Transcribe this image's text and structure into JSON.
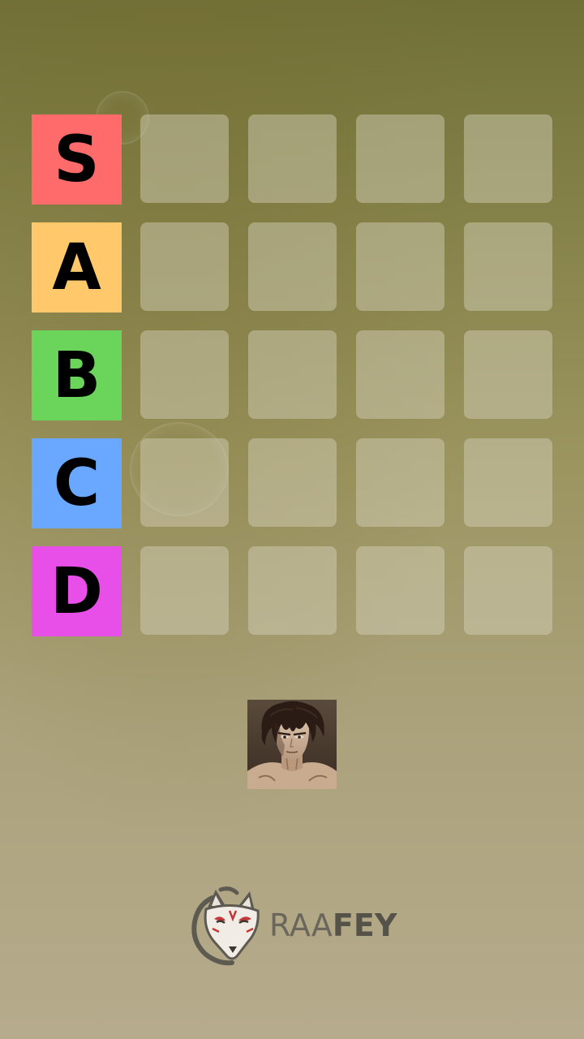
{
  "tiers": [
    {
      "label": "S",
      "color": "#ff6b6b"
    },
    {
      "label": "A",
      "color": "#ffc96b"
    },
    {
      "label": "B",
      "color": "#6bd45b"
    },
    {
      "label": "C",
      "color": "#6aa8ff"
    },
    {
      "label": "D",
      "color": "#e84ee8"
    }
  ],
  "slots_per_tier": 4,
  "pending_item": {
    "icon": "anime-character-portrait"
  },
  "brand": {
    "part1": "RAA",
    "part2": "FEY",
    "icon": "kitsune-fox-mask-icon"
  }
}
